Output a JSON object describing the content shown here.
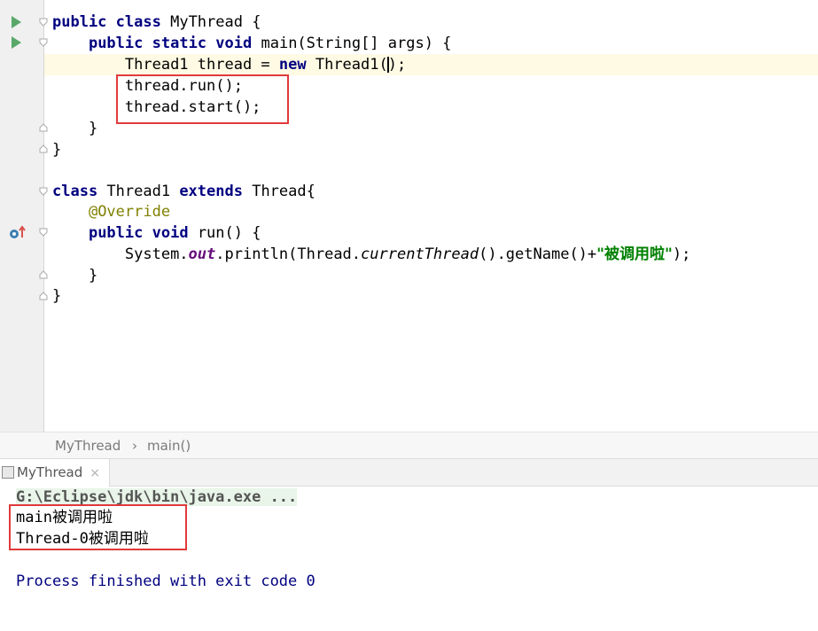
{
  "editor": {
    "lines": [
      {
        "kw1": "public",
        "kw2": "class",
        "rest": " MyThread {"
      },
      {
        "kw1": "public",
        "kw2": "static",
        "kw3": "void",
        "rest": " main(String[] args) {"
      },
      {
        "a": "Thread1 thread = ",
        "kw": "new",
        "b": " Thread1(",
        "c": ");"
      },
      {
        "text": "thread.run();"
      },
      {
        "text": "thread.start();"
      },
      {
        "text": "}"
      },
      {
        "text": "}"
      },
      {
        "kw1": "class",
        "mid": " Thread1 ",
        "kw2": "extends",
        "rest": " Thread{"
      },
      {
        "annotation": "@Override"
      },
      {
        "kw1": "public",
        "kw2": "void",
        "rest": " run() {"
      },
      {
        "a": "System.",
        "field": "out",
        "b": ".println(Thread.",
        "method": "currentThread",
        "c": "().getName()+",
        "str": "\"被调用啦\"",
        "d": ");"
      },
      {
        "text": "}"
      },
      {
        "text": "}"
      }
    ]
  },
  "breadcrumb": {
    "class": "MyThread",
    "separator": "›",
    "method": "main()"
  },
  "run_tab": {
    "label": "MyThread",
    "close": "×"
  },
  "console": {
    "command": "G:\\Eclipse\\jdk\\bin\\java.exe ...",
    "output": [
      {
        "thread": "main",
        "msg": "被调用啦"
      },
      {
        "thread": "Thread-0",
        "msg": "被调用啦"
      }
    ],
    "finished": "Process finished with exit code 0"
  },
  "colors": {
    "keyword": "#000080",
    "string": "#008000",
    "annotation": "#808000",
    "static_field": "#660e7a",
    "highlight_box": "#e03a3a",
    "run_icon": "#59a869"
  }
}
